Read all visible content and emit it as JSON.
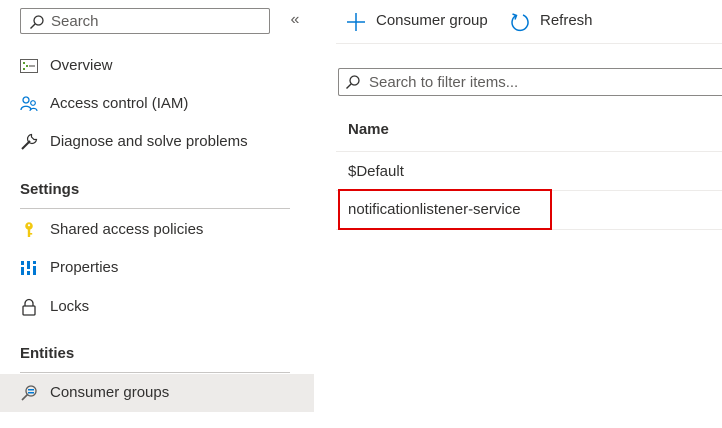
{
  "sidebar": {
    "search_placeholder": "Search",
    "collapse_glyph": "«",
    "items_top": [
      {
        "label": "Overview",
        "icon": "overview-icon"
      },
      {
        "label": "Access control (IAM)",
        "icon": "people-icon"
      },
      {
        "label": "Diagnose and solve problems",
        "icon": "wrench-icon"
      }
    ],
    "settings_header": "Settings",
    "settings_items": [
      {
        "label": "Shared access policies",
        "icon": "key-icon"
      },
      {
        "label": "Properties",
        "icon": "properties-icon"
      },
      {
        "label": "Locks",
        "icon": "lock-icon"
      }
    ],
    "entities_header": "Entities",
    "entities_items": [
      {
        "label": "Consumer groups",
        "icon": "consumer-groups-icon",
        "selected": true
      }
    ]
  },
  "toolbar": {
    "add_label": "Consumer group",
    "refresh_label": "Refresh"
  },
  "filter": {
    "placeholder": "Search to filter items..."
  },
  "table": {
    "column_header": "Name",
    "rows": [
      "$Default",
      "notificationlistener-service"
    ]
  },
  "colors": {
    "accent": "#0078d4",
    "highlight_border": "#e00000",
    "selected_bg": "#edebe9"
  }
}
